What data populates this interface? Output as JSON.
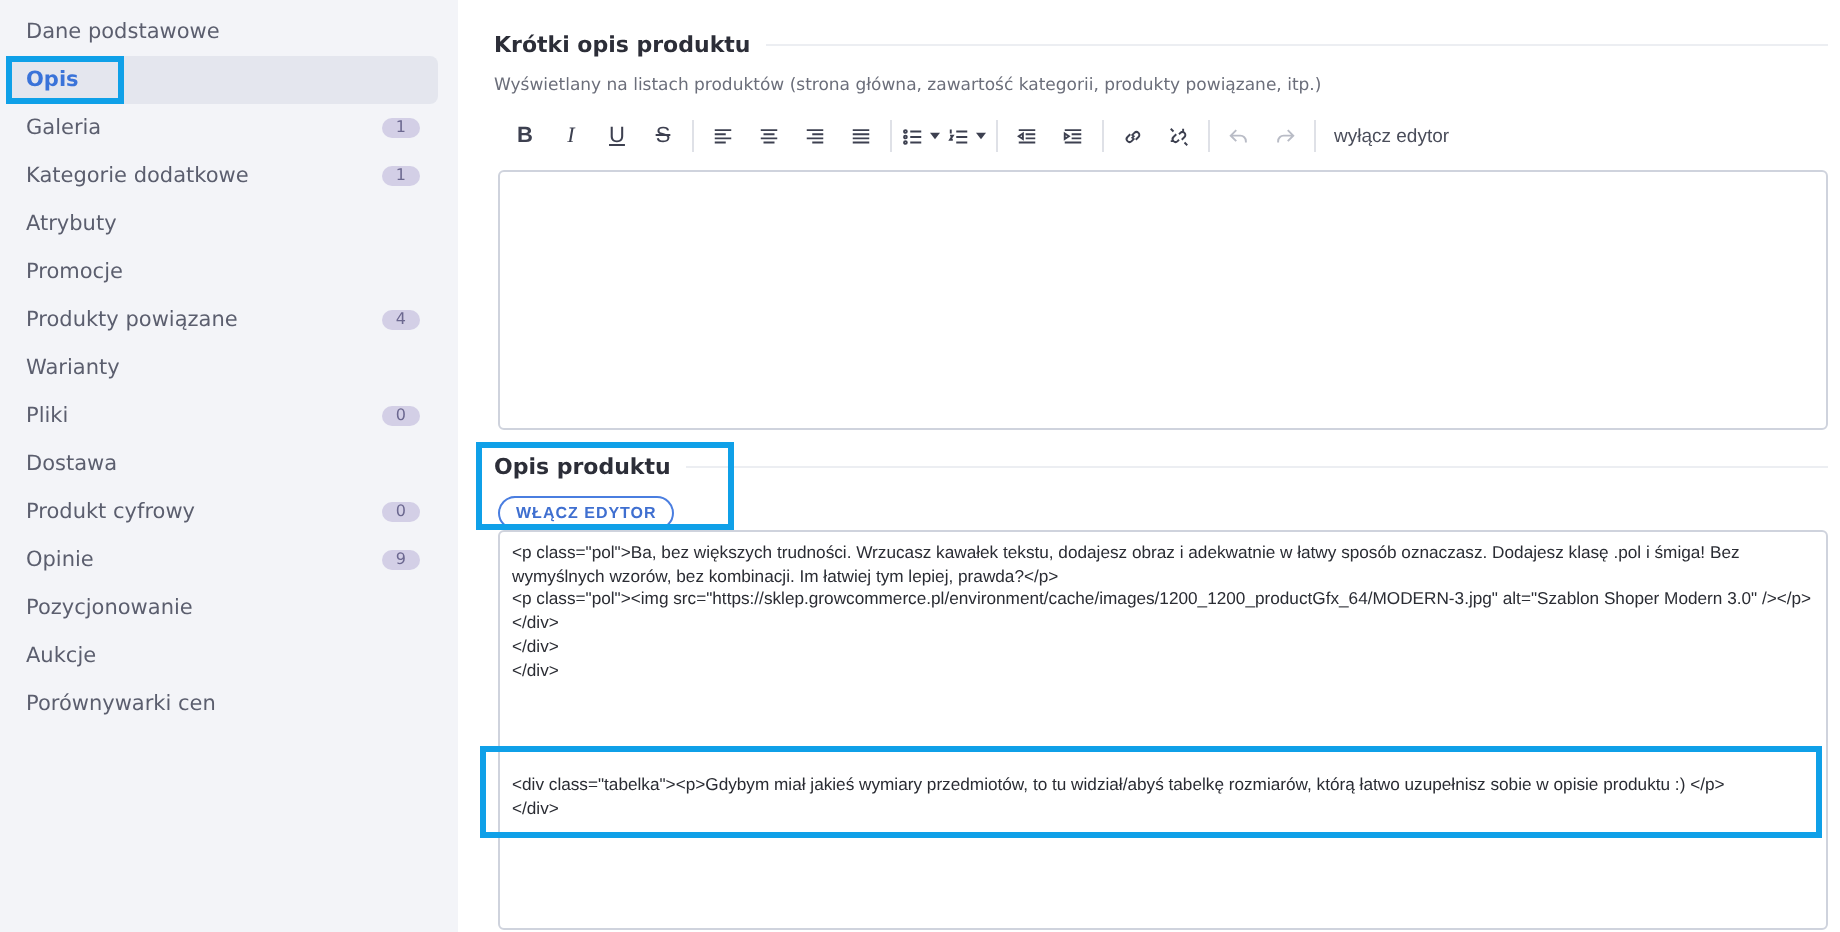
{
  "sidebar": {
    "items": [
      {
        "label": "Dane podstawowe",
        "selected": false
      },
      {
        "label": "Opis",
        "selected": true,
        "highlighted": true
      },
      {
        "label": "Galeria",
        "selected": false,
        "badge": "1"
      },
      {
        "label": "Kategorie dodatkowe",
        "selected": false,
        "badge": "1"
      },
      {
        "label": "Atrybuty",
        "selected": false
      },
      {
        "label": "Promocje",
        "selected": false
      },
      {
        "label": "Produkty powiązane",
        "selected": false,
        "badge": "4"
      },
      {
        "label": "Warianty",
        "selected": false
      },
      {
        "label": "Pliki",
        "selected": false,
        "badge": "0"
      },
      {
        "label": "Dostawa",
        "selected": false
      },
      {
        "label": "Produkt cyfrowy",
        "selected": false,
        "badge": "0"
      },
      {
        "label": "Opinie",
        "selected": false,
        "badge": "9"
      },
      {
        "label": "Pozycjonowanie",
        "selected": false
      },
      {
        "label": "Aukcje",
        "selected": false
      },
      {
        "label": "Porównywarki cen",
        "selected": false
      }
    ]
  },
  "short_description": {
    "title": "Krótki opis produktu",
    "hint": "Wyświetlany na listach produktów (strona główna, zawartość kategorii, produkty powiązane, itp.)",
    "toolbar": [
      {
        "kind": "bold",
        "glyph": "B",
        "disabled": false
      },
      {
        "kind": "italic",
        "glyph": "I",
        "disabled": false
      },
      {
        "kind": "underline",
        "glyph": "U",
        "disabled": false
      },
      {
        "kind": "strike",
        "glyph": "S",
        "disabled": false
      },
      {
        "kind": "separator"
      },
      {
        "kind": "align-left",
        "disabled": false
      },
      {
        "kind": "align-center",
        "disabled": false
      },
      {
        "kind": "align-right",
        "disabled": false
      },
      {
        "kind": "justify",
        "disabled": false
      },
      {
        "kind": "separator"
      },
      {
        "kind": "bullet-list",
        "disabled": false
      },
      {
        "kind": "numbered-list",
        "disabled": false
      },
      {
        "kind": "separator"
      },
      {
        "kind": "outdent",
        "disabled": false
      },
      {
        "kind": "indent",
        "disabled": false
      },
      {
        "kind": "separator"
      },
      {
        "kind": "link",
        "disabled": false
      },
      {
        "kind": "unlink",
        "disabled": false
      },
      {
        "kind": "separator"
      },
      {
        "kind": "undo",
        "disabled": true
      },
      {
        "kind": "redo",
        "disabled": true
      },
      {
        "kind": "separator"
      },
      {
        "kind": "text",
        "label": "wyłącz edytor",
        "disabled": false
      }
    ]
  },
  "description": {
    "title": "Opis produktu",
    "highlighted": true,
    "button": "WŁĄCZ EDYTOR",
    "code_blocks": [
      {
        "highlighted": false,
        "lines": [
          "<p class=\"pol\">Ba, bez większych trudności. Wrzucasz kawałek tekstu, dodajesz obraz i adekwatnie w łatwy sposób oznaczasz. Dodajesz klasę .pol i śmiga! Bez wymyślnych wzorów, bez kombinacji. Im łatwiej tym lepiej, prawda?</p>",
          "<p class=\"pol\"><img src=\"https://sklep.growcommerce.pl/environment/cache/images/1200_1200_productGfx_64/MODERN-3.jpg\" alt=\"Szablon Shoper Modern 3.0\" /></p>",
          "</div>",
          "</div>",
          "</div>"
        ]
      },
      {
        "highlighted": true,
        "lines": [
          "<div class=\"tabelka\"><p>Gdybym miał jakieś wymiary przedmiotów, to tu widział/abyś tabelkę rozmiarów, którą łatwo uzupełnisz sobie w opisie produktu :)  </p>",
          "</div>"
        ]
      }
    ]
  }
}
